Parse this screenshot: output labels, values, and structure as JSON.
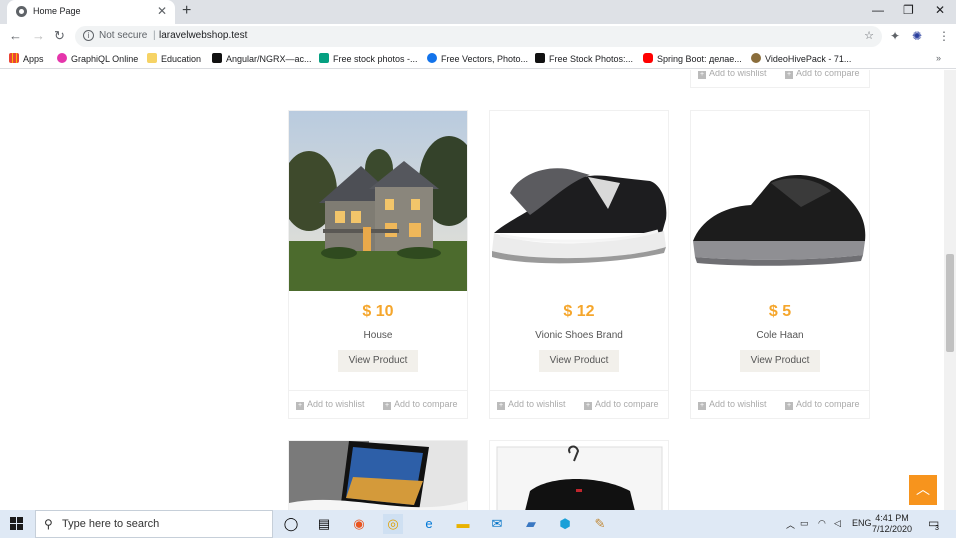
{
  "browser": {
    "tab_title": "Home Page",
    "security": "Not secure",
    "url": "laravelwebshop.test",
    "bookmarks": [
      "Apps",
      "GraphiQL Online",
      "Education",
      "Angular/NGRX—ас...",
      "Free stock photos -...",
      "Free Vectors, Photo...",
      "Free Stock Photos:...",
      "Spring Boot: делае...",
      "VideoHivePack - 71..."
    ]
  },
  "products": [
    {
      "price": "$ 10",
      "name": "House",
      "view_label": "View Product",
      "wishlist_label": "Add to wishlist",
      "compare_label": "Add to compare"
    },
    {
      "price": "$ 12",
      "name": "Vionic Shoes Brand",
      "view_label": "View Product",
      "wishlist_label": "Add to wishlist",
      "compare_label": "Add to compare"
    },
    {
      "price": "$ 5",
      "name": "Cole Haan",
      "view_label": "View Product",
      "wishlist_label": "Add to wishlist",
      "compare_label": "Add to compare"
    }
  ],
  "prev_row": {
    "wishlist_label": "Add to wishlist",
    "compare_label": "Add to compare"
  },
  "taskbar": {
    "search_placeholder": "Type here to search",
    "language": "ENG",
    "time": "4:41 PM",
    "date": "7/12/2020",
    "notifications": "3"
  }
}
